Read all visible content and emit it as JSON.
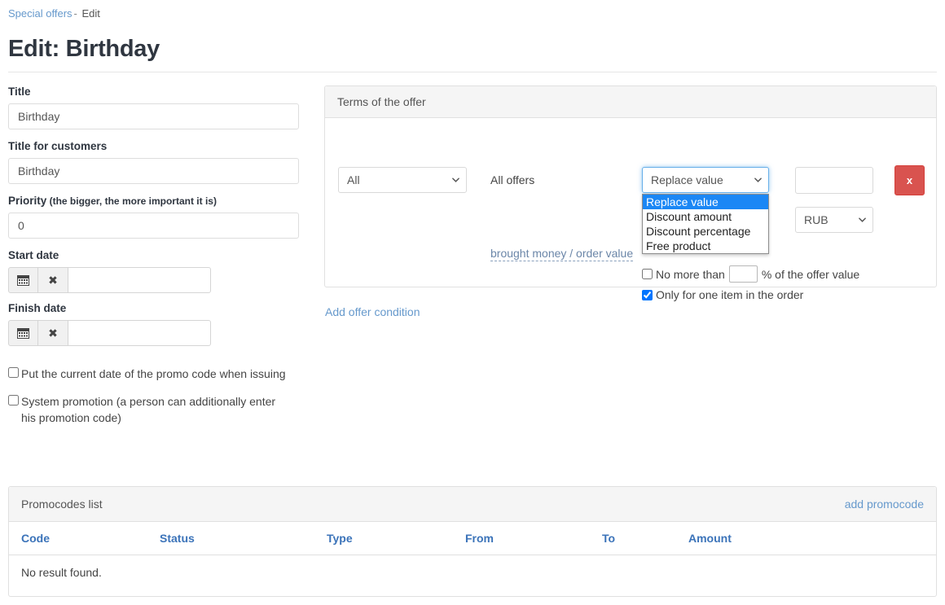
{
  "breadcrumb": {
    "parent": "Special offers",
    "separator": "-",
    "current": "Edit"
  },
  "page_title": "Edit: Birthday",
  "form": {
    "title": {
      "label": "Title",
      "value": "Birthday"
    },
    "title_for_customers": {
      "label": "Title for customers",
      "value": "Birthday"
    },
    "priority": {
      "label": "Priority",
      "hint": " (the bigger, the more important it is)",
      "value": "0"
    },
    "start_date": {
      "label": "Start date",
      "value": "",
      "calendar_icon": "calendar-icon",
      "clear_icon": "✖"
    },
    "finish_date": {
      "label": "Finish date",
      "value": "",
      "calendar_icon": "calendar-icon",
      "clear_icon": "✖"
    },
    "checkbox_current_date": {
      "label": "Put the current date of the promo code when issuing",
      "checked": false
    },
    "checkbox_system_promotion": {
      "label": "System promotion (a person can additionally enter his promotion code)",
      "checked": false
    }
  },
  "terms_panel": {
    "heading": "Terms of the offer",
    "scope_select": {
      "value": "All"
    },
    "scope_text": "All offers",
    "money_link": "brought money / order value",
    "type_select": {
      "value": "Replace value",
      "open": true,
      "options": [
        "Replace value",
        "Discount amount",
        "Discount percentage",
        "Free product"
      ],
      "selected_index": 0
    },
    "amount_input": {
      "value": "",
      "placeholder": ""
    },
    "currency_select": {
      "value": "RUB"
    },
    "remove_button": {
      "label": "x",
      "color": "#d9534f"
    },
    "no_more_than": {
      "prefix": "No more than",
      "input_value": "",
      "suffix": "% of the offer value",
      "checked": false
    },
    "only_one_item": {
      "label": "Only for one item in the order",
      "checked": true
    },
    "add_condition_link": "Add offer condition"
  },
  "promocodes": {
    "heading": "Promocodes list",
    "add_link": "add promocode",
    "columns": [
      "Code",
      "Status",
      "Type",
      "From",
      "To",
      "Amount"
    ],
    "empty_message": "No result found.",
    "rows": []
  },
  "colors": {
    "link": "#6699cc",
    "table_header": "#3b73b9",
    "danger": "#d9534f",
    "highlight": "#1b87f5",
    "panel_header_bg": "#f5f5f5"
  }
}
